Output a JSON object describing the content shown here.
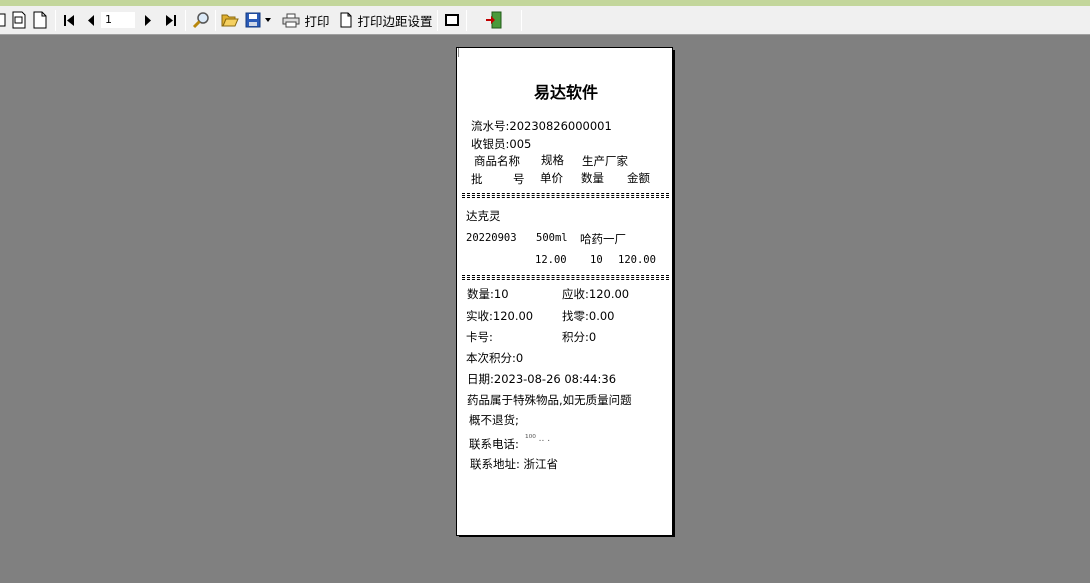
{
  "toolbar": {
    "page_number": "1",
    "print_label": "打印",
    "margin_label": "打印边距设置"
  },
  "receipt": {
    "title": "易达软件",
    "serial": "流水号:20230826000001",
    "cashier": "收银员:005",
    "header1": [
      "商品名称",
      "规格",
      "生产厂家"
    ],
    "header2": [
      "批",
      "号",
      "单价",
      "数量",
      "金额"
    ],
    "item": {
      "name": "达克灵",
      "batch": "20220903",
      "spec": "500ml",
      "maker": "哈药一厂",
      "price": "12.00",
      "qty": "10",
      "amount": "120.00"
    },
    "summary": {
      "qty": "数量:10",
      "receivable": "应收:120.00",
      "paid": "实收:120.00",
      "change": "找零:0.00",
      "card": "卡号:",
      "points": "积分:0",
      "this_points": "本次积分:0",
      "date": "日期:2023-08-26 08:44:36"
    },
    "notice1": "药品属于特殊物品,如无质量问题",
    "notice2": "概不退货;",
    "phone": "联系电话:",
    "phone_partial": "¹⁰⁰  ..       .",
    "address": "联系地址: 浙江省"
  }
}
